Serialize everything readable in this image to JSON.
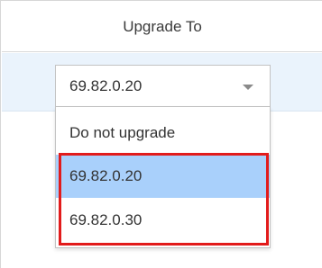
{
  "table": {
    "column_header": "Upgrade To"
  },
  "version_select": {
    "selected_value": "69.82.0.20",
    "options": [
      {
        "label": "Do not upgrade"
      },
      {
        "label": "69.82.0.20",
        "selected": true
      },
      {
        "label": "69.82.0.30"
      }
    ]
  },
  "colors": {
    "row_highlight": "#eaf3fc",
    "selected_option": "#a9d0fb",
    "annotation_box": "#e21b1b",
    "border": "#c3c3c3"
  },
  "icons": {
    "caret": "chevron-down-icon"
  }
}
